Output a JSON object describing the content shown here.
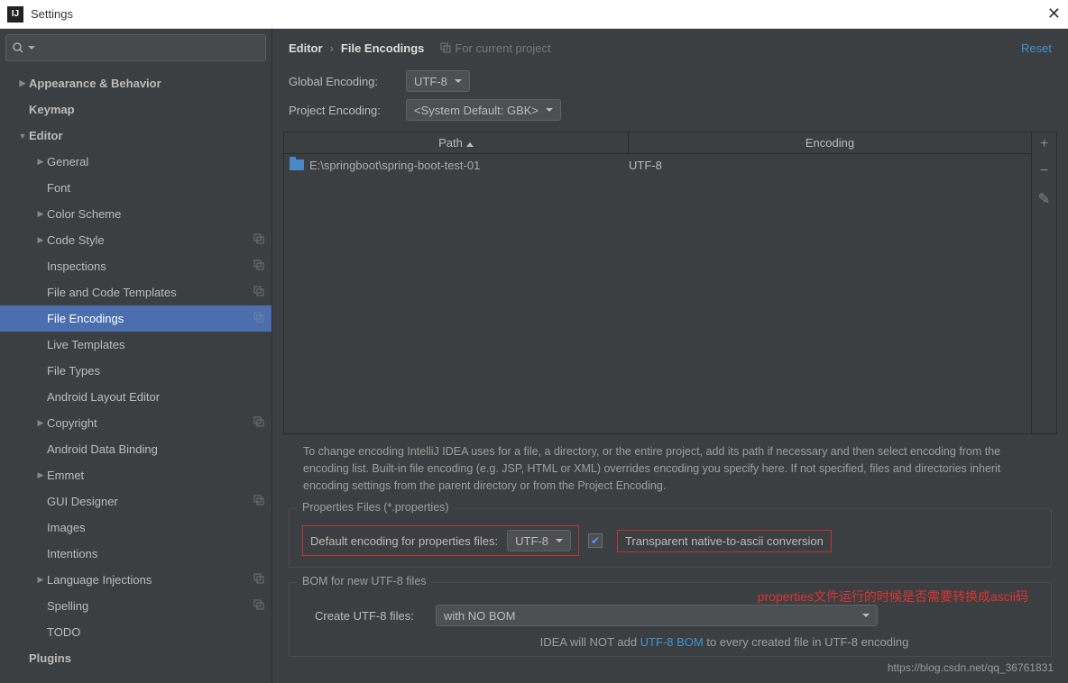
{
  "window": {
    "title": "Settings"
  },
  "sidebar": {
    "items": [
      {
        "label": "Appearance & Behavior",
        "level": 0,
        "arrow": "right",
        "bold": true
      },
      {
        "label": "Keymap",
        "level": 0,
        "arrow": "",
        "bold": true
      },
      {
        "label": "Editor",
        "level": 0,
        "arrow": "down",
        "bold": true
      },
      {
        "label": "General",
        "level": 1,
        "arrow": "right"
      },
      {
        "label": "Font",
        "level": 1,
        "arrow": ""
      },
      {
        "label": "Color Scheme",
        "level": 1,
        "arrow": "right"
      },
      {
        "label": "Code Style",
        "level": 1,
        "arrow": "right",
        "copy": true
      },
      {
        "label": "Inspections",
        "level": 1,
        "arrow": "",
        "copy": true
      },
      {
        "label": "File and Code Templates",
        "level": 1,
        "arrow": "",
        "copy": true
      },
      {
        "label": "File Encodings",
        "level": 1,
        "arrow": "",
        "copy": true,
        "sel": true
      },
      {
        "label": "Live Templates",
        "level": 1,
        "arrow": ""
      },
      {
        "label": "File Types",
        "level": 1,
        "arrow": ""
      },
      {
        "label": "Android Layout Editor",
        "level": 1,
        "arrow": ""
      },
      {
        "label": "Copyright",
        "level": 1,
        "arrow": "right",
        "copy": true
      },
      {
        "label": "Android Data Binding",
        "level": 1,
        "arrow": ""
      },
      {
        "label": "Emmet",
        "level": 1,
        "arrow": "right"
      },
      {
        "label": "GUI Designer",
        "level": 1,
        "arrow": "",
        "copy": true
      },
      {
        "label": "Images",
        "level": 1,
        "arrow": ""
      },
      {
        "label": "Intentions",
        "level": 1,
        "arrow": ""
      },
      {
        "label": "Language Injections",
        "level": 1,
        "arrow": "right",
        "copy": true
      },
      {
        "label": "Spelling",
        "level": 1,
        "arrow": "",
        "copy": true
      },
      {
        "label": "TODO",
        "level": 1,
        "arrow": ""
      },
      {
        "label": "Plugins",
        "level": 0,
        "arrow": "",
        "bold": true
      }
    ]
  },
  "breadcrumb": {
    "a": "Editor",
    "b": "File Encodings",
    "proj": "For current project",
    "reset": "Reset"
  },
  "global": {
    "label": "Global Encoding:",
    "value": "UTF-8"
  },
  "project": {
    "label": "Project Encoding:",
    "value": "<System Default: GBK>"
  },
  "table": {
    "hdr_path": "Path",
    "hdr_enc": "Encoding",
    "row_path": "E:\\springboot\\spring-boot-test-01",
    "row_enc": "UTF-8"
  },
  "help": "To change encoding IntelliJ IDEA uses for a file, a directory, or the entire project, add its path if necessary and then select encoding from the encoding list. Built-in file encoding (e.g. JSP, HTML or XML) overrides encoding you specify here. If not specified, files and directories inherit encoding settings from the parent directory or from the Project Encoding.",
  "props": {
    "legend": "Properties Files (*.properties)",
    "deflabel": "Default encoding for properties files:",
    "defval": "UTF-8",
    "trans": "Transparent native-to-ascii conversion"
  },
  "annotation": "properties文件运行的时候是否需要转换成ascii码",
  "bom": {
    "legend": "BOM for new UTF-8 files",
    "label": "Create UTF-8 files:",
    "value": "with NO BOM",
    "help_a": "IDEA will NOT add ",
    "help_link": "UTF-8 BOM",
    "help_b": " to every created file in UTF-8 encoding"
  },
  "watermark": "https://blog.csdn.net/qq_36761831"
}
